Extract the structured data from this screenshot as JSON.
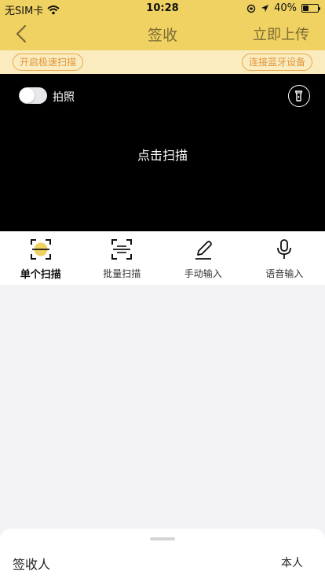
{
  "status_bar": {
    "carrier": "无SIM卡",
    "time": "10:28",
    "battery": "40%",
    "battery_level": 0.4
  },
  "nav": {
    "back_icon": "chevron-left-icon",
    "title": "签收",
    "action": "立即上传"
  },
  "options": {
    "fast_scan": "开启极速扫描",
    "bluetooth": "连接蓝牙设备"
  },
  "camera": {
    "photo_toggle_on": false,
    "photo_label": "拍照",
    "flash_icon": "flashlight-icon",
    "prompt": "点击扫描"
  },
  "modes": [
    {
      "label": "单个扫描",
      "icon": "single-scan-icon",
      "active": true
    },
    {
      "label": "批量扫描",
      "icon": "batch-scan-icon",
      "active": false
    },
    {
      "label": "手动输入",
      "icon": "pencil-icon",
      "active": false
    },
    {
      "label": "语音输入",
      "icon": "microphone-icon",
      "active": false
    }
  ],
  "sheet": {
    "signer_label": "签收人",
    "signer_value": "本人"
  },
  "colors": {
    "header": "#f0d263",
    "options_bar": "#faecbf",
    "pill_accent": "#e0953a",
    "camera_bg": "#000000"
  }
}
